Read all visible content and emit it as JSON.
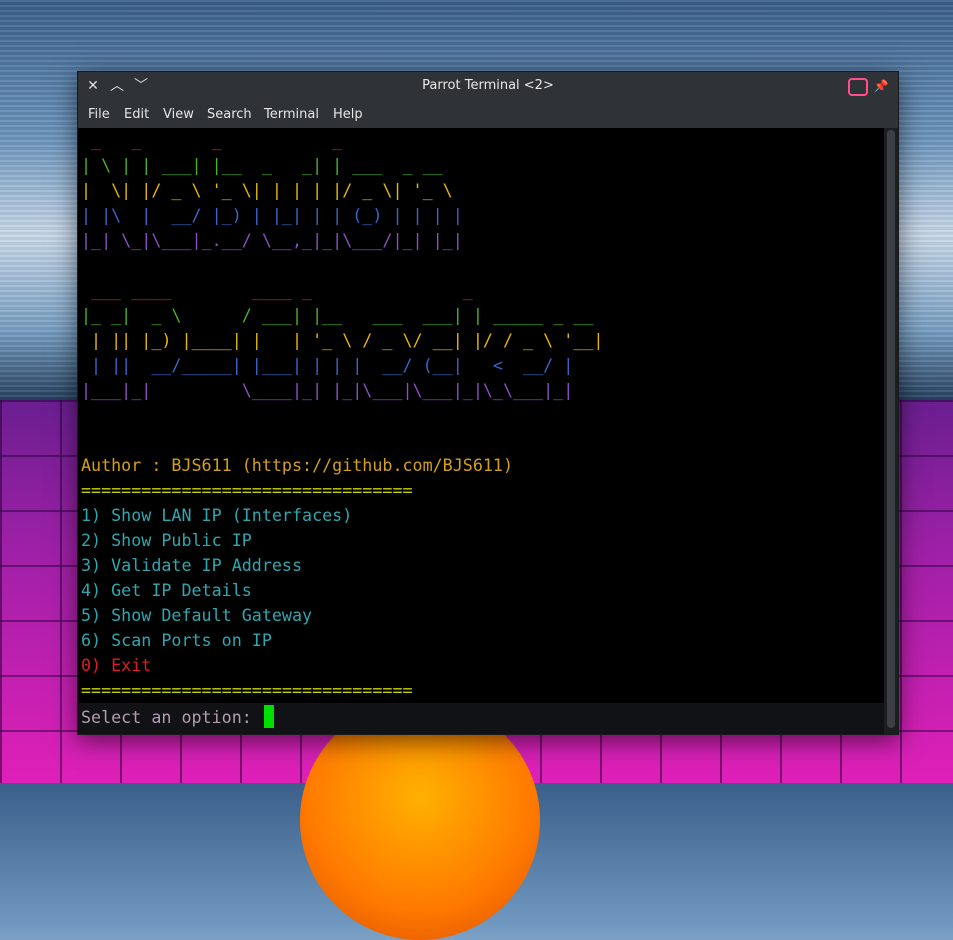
{
  "window": {
    "title": "Parrot Terminal <2>"
  },
  "menubar": {
    "file": "File",
    "edit": "Edit",
    "view": "View",
    "search": "Search",
    "terminal": "Terminal",
    "help": "Help"
  },
  "banner1": [
    " _   _       _           _",
    "| \\ | | ___| |__  _   _| | ___  _ __",
    "|  \\| |/ _ \\ '_ \\| | | | |/ _ \\| '_ \\",
    "| |\\  |  __/ |_) | |_| | | (_) | | | |",
    "|_| \\_|\\___|_.__/ \\__,_|_|\\___/|_| |_|"
  ],
  "banner2": [
    " ___ ____        ____ _               _",
    "|_ _|  _ \\      / ___| |__   ___  ___| | _____ _ __",
    " | || |_) |____| |   | '_ \\ / _ \\/ __| |/ / _ \\ '__|",
    " | ||  __/_____| |___| | | |  __/ (__|   <  __/ |",
    "|___|_|         \\____|_| |_|\\___|\\___|_|\\_\\___|_|"
  ],
  "author": "Author : BJS611 (https://github.com/BJS611)",
  "separator": "=================================",
  "menu": [
    "1) Show LAN IP (Interfaces)",
    "2) Show Public IP",
    "3) Validate IP Address",
    "4) Get IP Details",
    "5) Show Default Gateway",
    "6) Scan Ports on IP"
  ],
  "exit": "0) Exit",
  "prompt": "Select an option: ",
  "colors": {
    "red": "#e01b24",
    "green": "#4caf2a",
    "yellow": "#e5b50a",
    "blue": "#3a66c9",
    "purple": "#8a4fc2",
    "cyan": "#2ea7b0",
    "gold": "#d4a017",
    "gray_prompt": "#b49cb4"
  }
}
